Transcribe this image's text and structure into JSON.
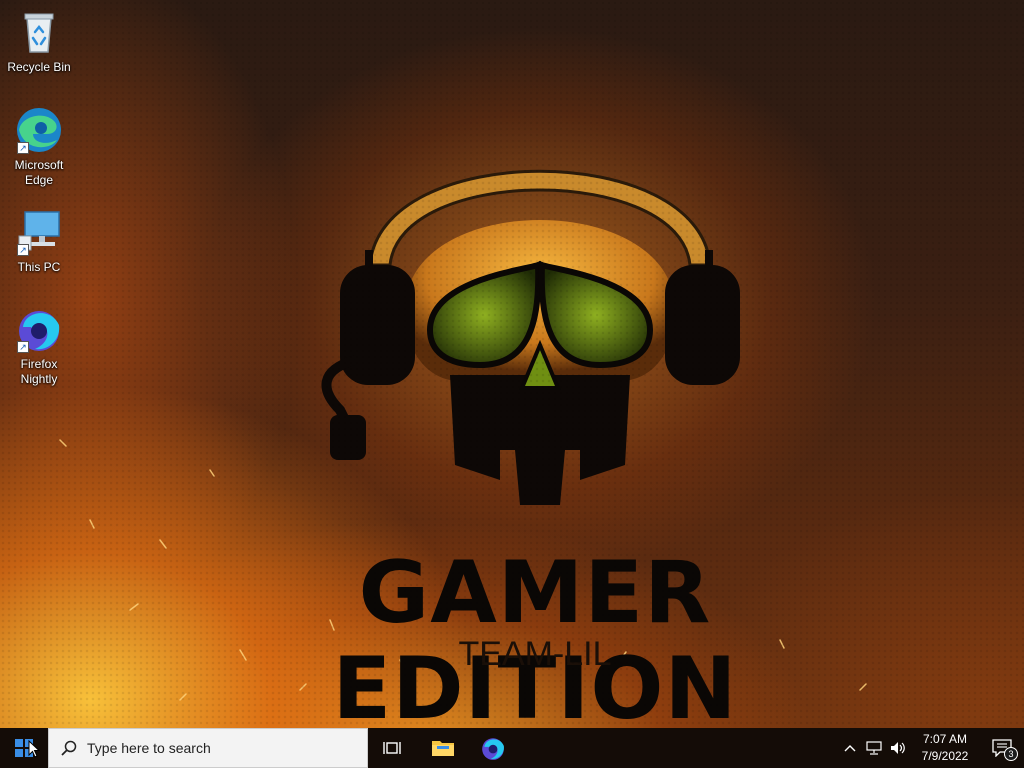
{
  "desktop": {
    "icons": [
      {
        "label": "Recycle Bin",
        "icon": "recycle-bin-icon"
      },
      {
        "label": "Microsoft Edge",
        "icon": "edge-icon",
        "shortcut": true
      },
      {
        "label": "This PC",
        "icon": "this-pc-icon",
        "shortcut": true
      },
      {
        "label": "Firefox Nightly",
        "icon": "firefox-nightly-icon",
        "shortcut": true
      }
    ]
  },
  "wallpaper": {
    "title": "GAMER EDITION",
    "subtitle": "TEAM-LIL",
    "colors": {
      "accent": "#f2a531",
      "eyes": "#6f8f12",
      "dark": "#0a0705"
    }
  },
  "taskbar": {
    "search_placeholder": "Type here to search",
    "pinned": [
      {
        "name": "task-view",
        "icon": "task-view-icon"
      },
      {
        "name": "file-explorer",
        "icon": "folder-icon"
      },
      {
        "name": "firefox-nightly",
        "icon": "firefox-nightly-icon"
      }
    ],
    "clock": {
      "time": "7:07 AM",
      "date": "7/9/2022"
    },
    "notifications": {
      "count": "3"
    }
  }
}
